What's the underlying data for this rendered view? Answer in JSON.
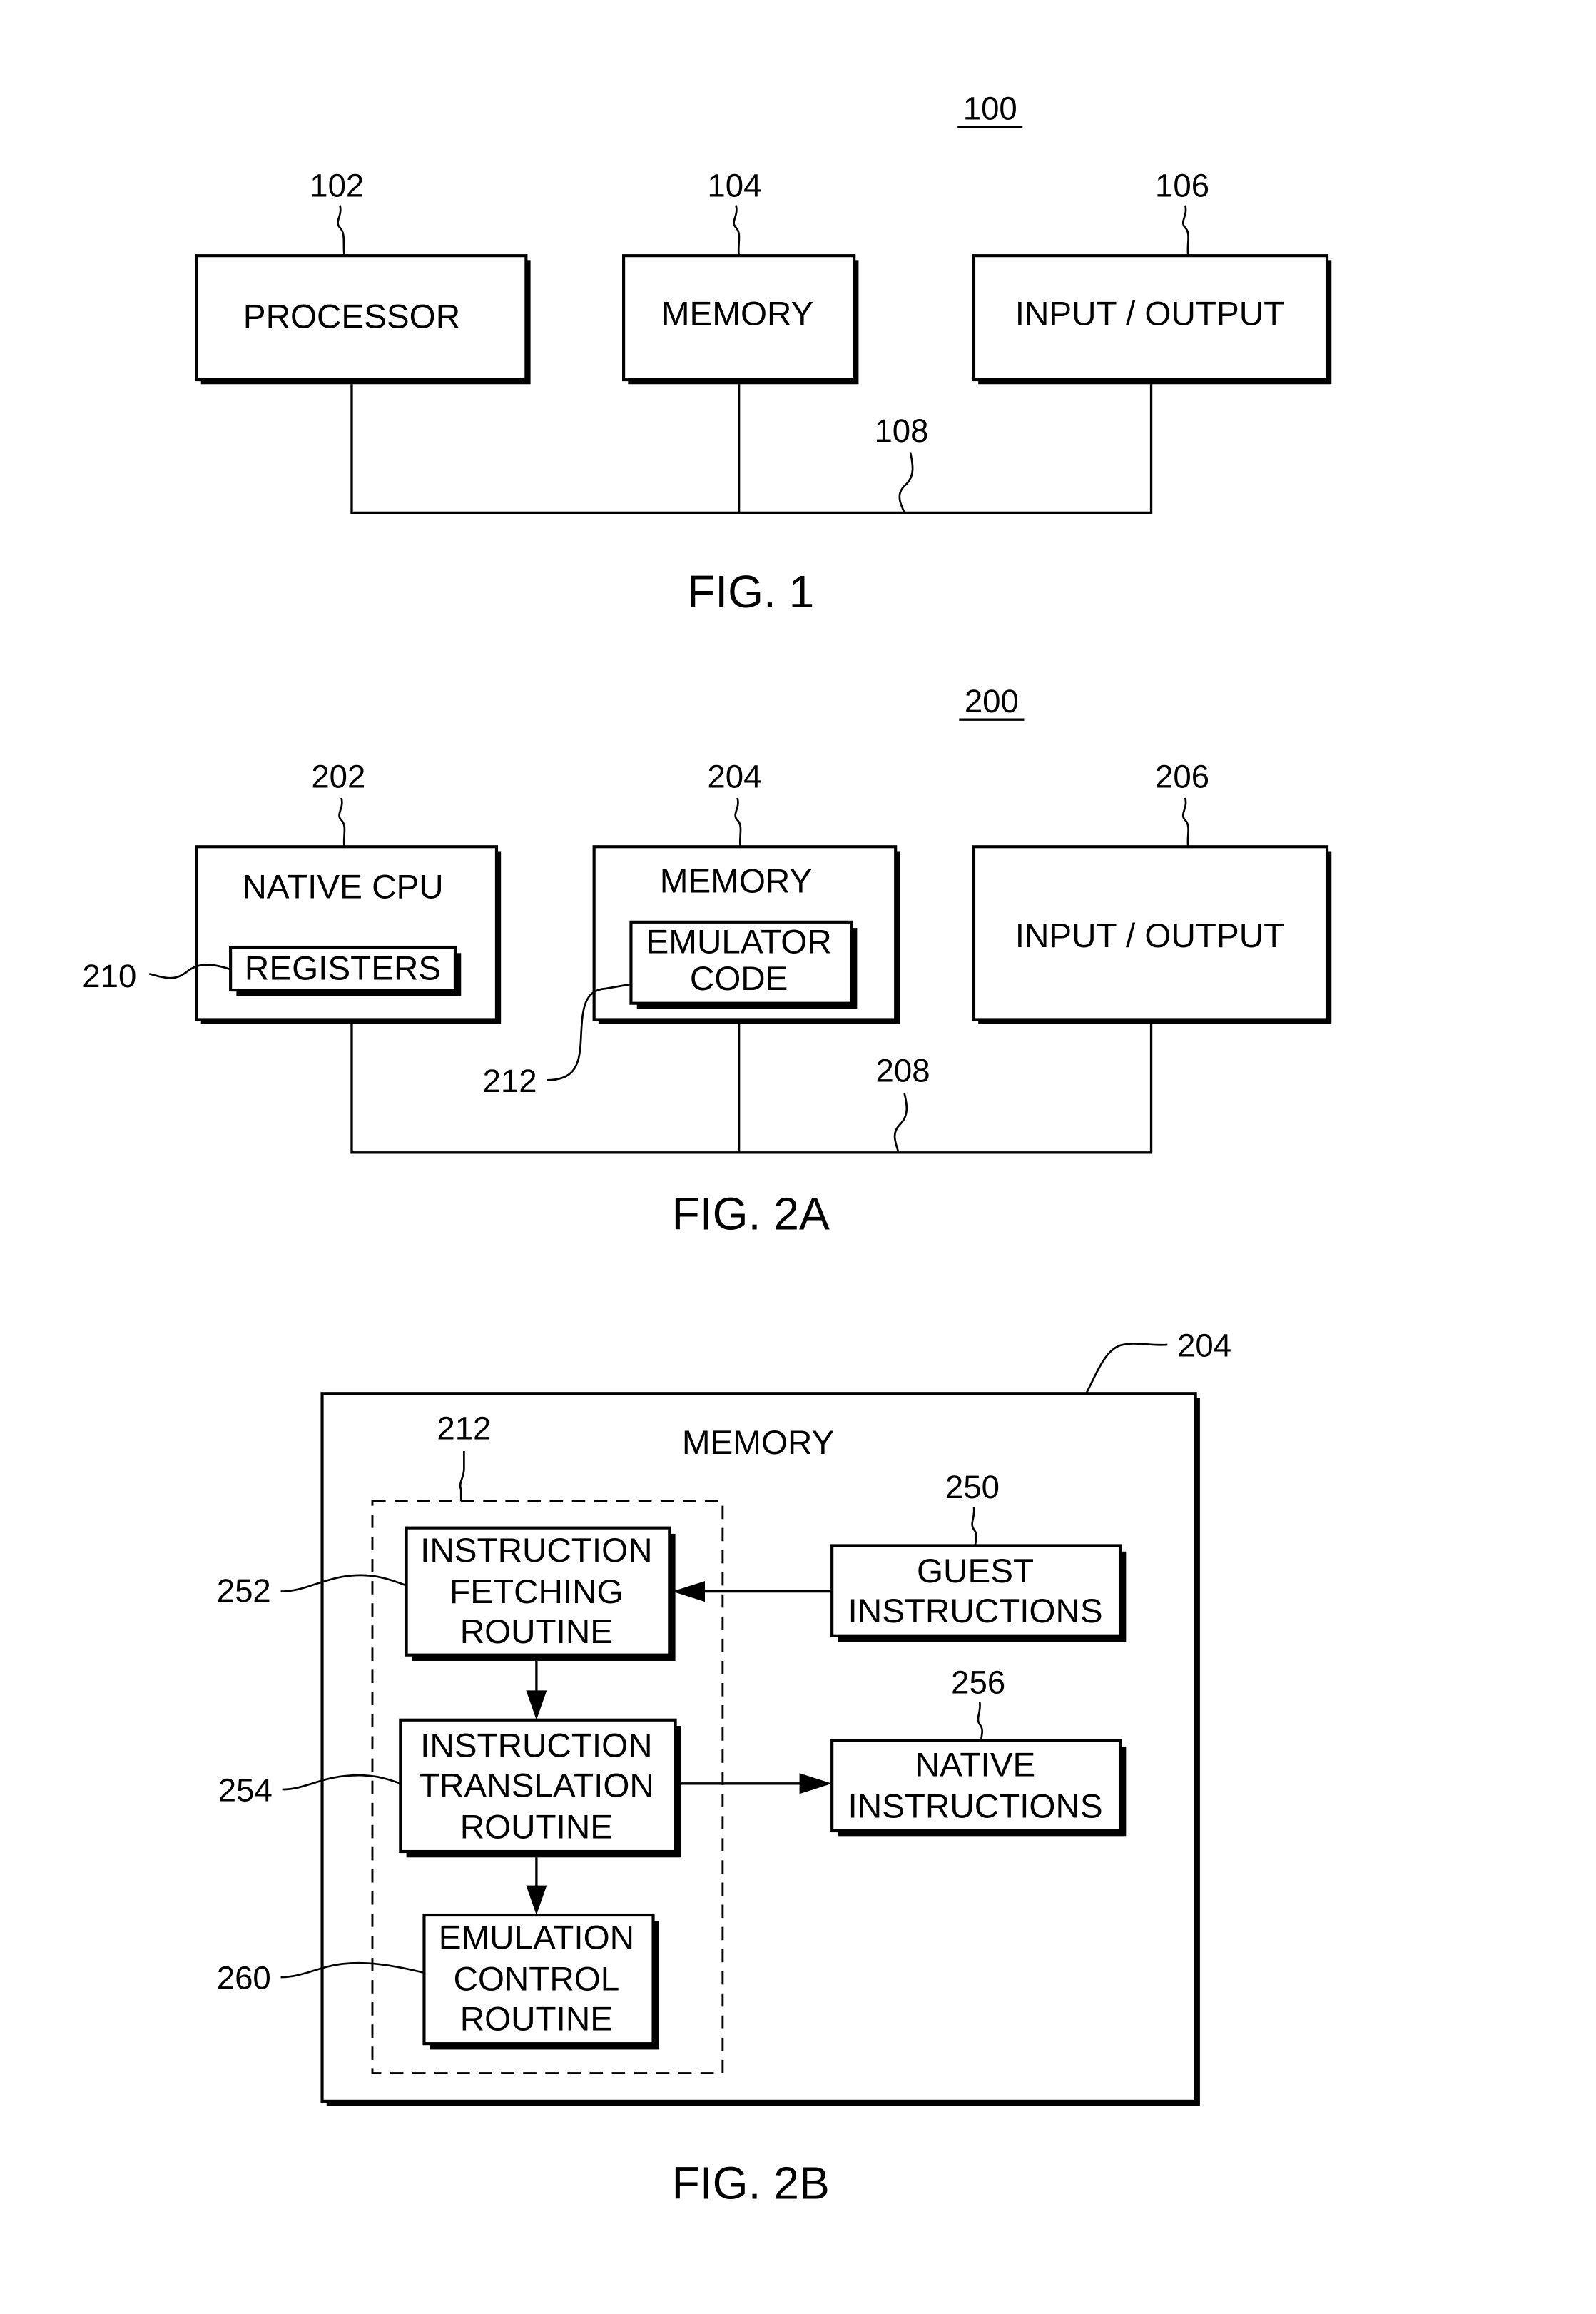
{
  "fig1": {
    "ref_system": "100",
    "processor": {
      "ref": "102",
      "label": "PROCESSOR"
    },
    "memory": {
      "ref": "104",
      "label": "MEMORY"
    },
    "io": {
      "ref": "106",
      "label": "INPUT / OUTPUT"
    },
    "bus": {
      "ref": "108"
    },
    "caption": "FIG. 1"
  },
  "fig2a": {
    "ref_system": "200",
    "cpu": {
      "ref": "202",
      "label": "NATIVE CPU"
    },
    "registers": {
      "ref": "210",
      "label": "REGISTERS"
    },
    "memory": {
      "ref": "204",
      "label": "MEMORY"
    },
    "emulator_code": {
      "ref": "212",
      "line1": "EMULATOR",
      "line2": "CODE"
    },
    "io": {
      "ref": "206",
      "label": "INPUT / OUTPUT"
    },
    "bus": {
      "ref": "208"
    },
    "caption": "FIG. 2A"
  },
  "fig2b": {
    "memory": {
      "ref": "204",
      "label": "MEMORY"
    },
    "emulator_code": {
      "ref": "212"
    },
    "fetching": {
      "ref": "252",
      "lines": [
        "INSTRUCTION",
        "FETCHING",
        "ROUTINE"
      ]
    },
    "translation": {
      "ref": "254",
      "lines": [
        "INSTRUCTION",
        "TRANSLATION",
        "ROUTINE"
      ]
    },
    "control": {
      "ref": "260",
      "lines": [
        "EMULATION",
        "CONTROL",
        "ROUTINE"
      ]
    },
    "guest": {
      "ref": "250",
      "lines": [
        "GUEST",
        "INSTRUCTIONS"
      ]
    },
    "native": {
      "ref": "256",
      "lines": [
        "NATIVE",
        "INSTRUCTIONS"
      ]
    },
    "caption": "FIG. 2B"
  }
}
